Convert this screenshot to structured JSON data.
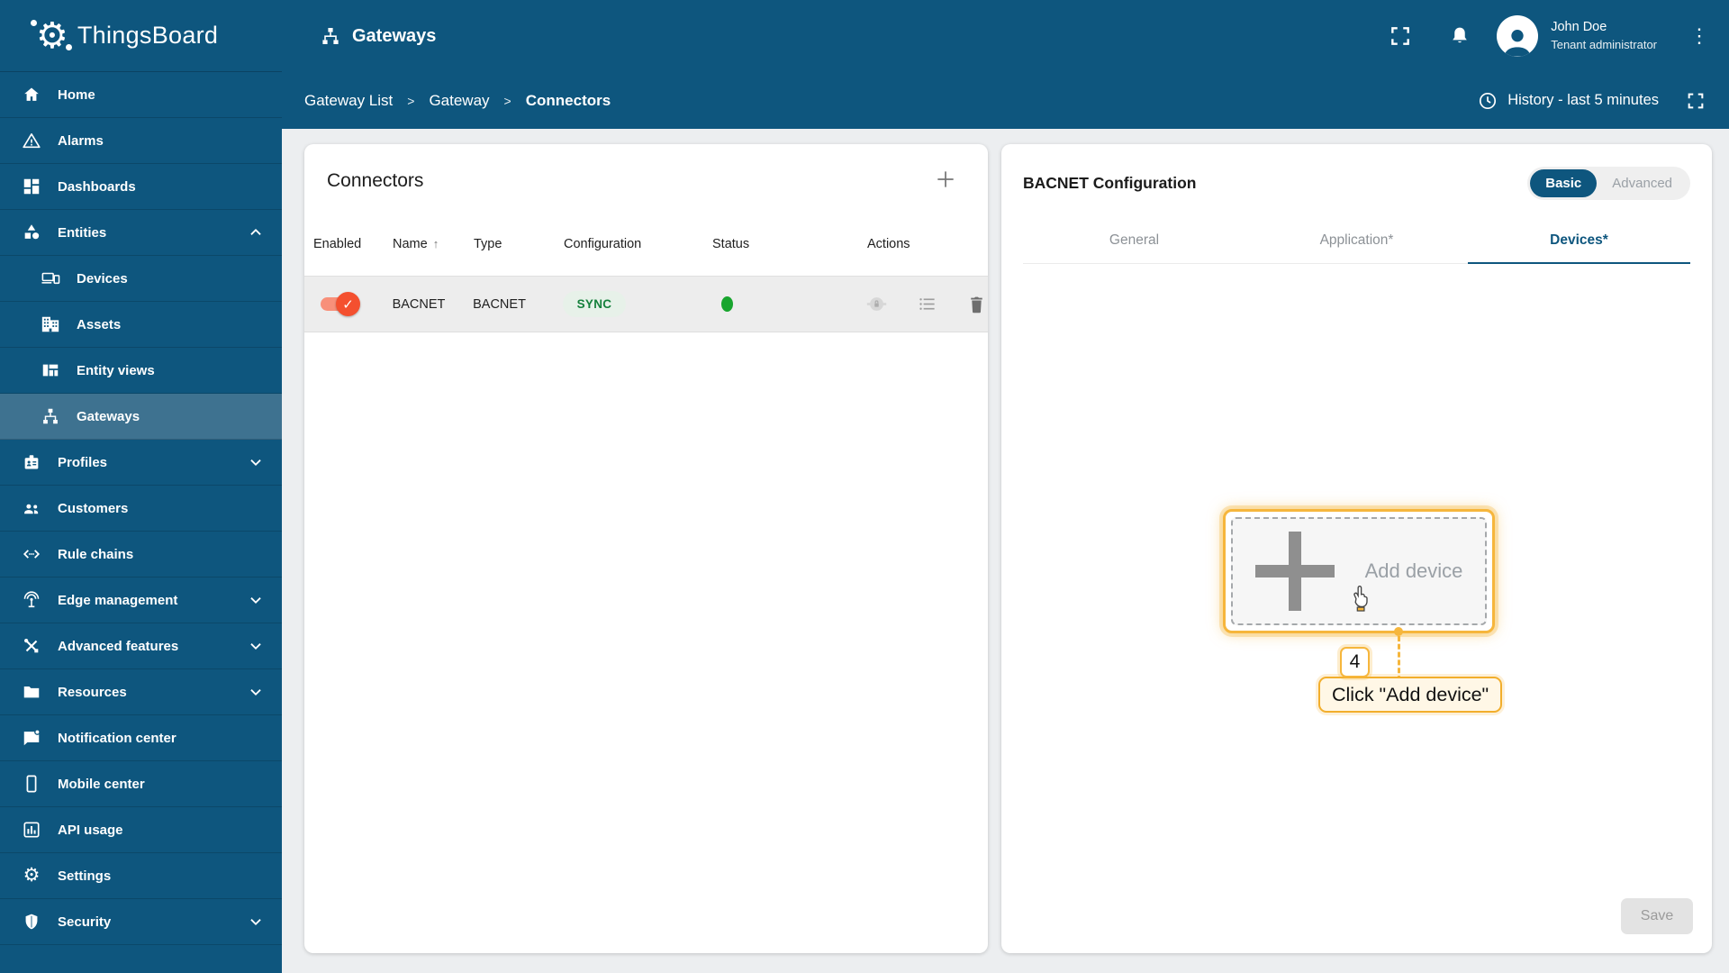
{
  "topbar": {
    "logo_text": "ThingsBoard",
    "page_title": "Gateways",
    "user": {
      "name": "John Doe",
      "role": "Tenant administrator"
    }
  },
  "breadcrumb": {
    "items": [
      "Gateway List",
      "Gateway",
      "Connectors"
    ],
    "separator": ">",
    "history_label": "History - last 5 minutes"
  },
  "sidebar": {
    "items": [
      {
        "label": "Home",
        "icon": "home-icon"
      },
      {
        "label": "Alarms",
        "icon": "alarm-icon"
      },
      {
        "label": "Dashboards",
        "icon": "dashboards-icon"
      },
      {
        "label": "Entities",
        "icon": "entities-icon",
        "chevron": "up"
      },
      {
        "label": "Devices",
        "icon": "devices-icon",
        "indent": true
      },
      {
        "label": "Assets",
        "icon": "assets-icon",
        "indent": true
      },
      {
        "label": "Entity views",
        "icon": "entity-views-icon",
        "indent": true
      },
      {
        "label": "Gateways",
        "icon": "gateways-icon",
        "indent": true,
        "selected": true
      },
      {
        "label": "Profiles",
        "icon": "profiles-icon",
        "chevron": "down"
      },
      {
        "label": "Customers",
        "icon": "customers-icon"
      },
      {
        "label": "Rule chains",
        "icon": "rule-chains-icon"
      },
      {
        "label": "Edge management",
        "icon": "edge-management-icon",
        "chevron": "down"
      },
      {
        "label": "Advanced features",
        "icon": "advanced-features-icon",
        "chevron": "down"
      },
      {
        "label": "Resources",
        "icon": "resources-icon",
        "chevron": "down"
      },
      {
        "label": "Notification center",
        "icon": "notification-center-icon"
      },
      {
        "label": "Mobile center",
        "icon": "mobile-center-icon"
      },
      {
        "label": "API usage",
        "icon": "api-usage-icon"
      },
      {
        "label": "Settings",
        "icon": "settings-icon"
      },
      {
        "label": "Security",
        "icon": "security-icon",
        "chevron": "down"
      }
    ]
  },
  "connectors_card": {
    "title": "Connectors",
    "columns": [
      "Enabled",
      "Name",
      "Type",
      "Configuration",
      "Status",
      "Actions"
    ],
    "rows": [
      {
        "enabled": true,
        "name": "BACNET",
        "type": "BACNET",
        "configuration": "SYNC",
        "status": "connected"
      }
    ]
  },
  "config_panel": {
    "title": "BACNET Configuration",
    "mode": {
      "options": [
        "Basic",
        "Advanced"
      ],
      "selected": "Basic"
    },
    "tabs": [
      {
        "label": "General"
      },
      {
        "label": "Application*"
      },
      {
        "label": "Devices*",
        "active": true
      }
    ],
    "add_device_label": "Add device",
    "save_label": "Save"
  },
  "annotation": {
    "step": "4",
    "label": "Click \"Add device\""
  },
  "colors": {
    "primary": "#0E567E",
    "highlight": "#F6B63C",
    "toggle_on": "#F4502F",
    "status_green": "#18A52E",
    "sync_green": "#15803C"
  }
}
